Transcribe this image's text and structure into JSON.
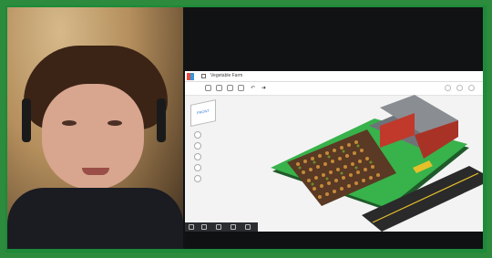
{
  "app": {
    "title": "Vegetable Farm",
    "viewcube_label": "FRONT"
  },
  "colors": {
    "frame": "#2c8b3c",
    "baseplate": "#38b24a",
    "soil": "#5a3a24",
    "road": "#2a2a2a",
    "barn_red": "#c0392b",
    "barn_roof": "#6f7379"
  },
  "icons": {
    "toolbar_left": [
      "copy-icon",
      "paste-icon",
      "duplicate-icon",
      "delete-icon",
      "undo-icon",
      "redo-icon"
    ],
    "toolbar_right": [
      "light-icon",
      "group-icon",
      "align-icon"
    ],
    "side_tools": [
      "home-view-icon",
      "fit-view-icon",
      "zoom-in-icon",
      "zoom-out-icon",
      "perspective-icon"
    ],
    "bottom_tools": [
      "select-icon",
      "pan-icon",
      "brush-icon",
      "ruler-icon",
      "close-icon"
    ]
  }
}
